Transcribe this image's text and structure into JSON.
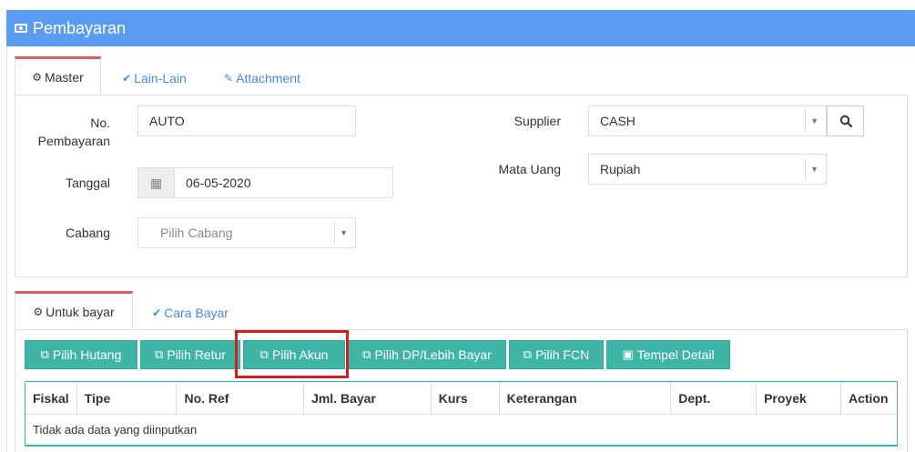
{
  "header": {
    "title": "Pembayaran",
    "icon": "money-icon"
  },
  "top_tabs": [
    {
      "label": "Master",
      "icon": "cogs-icon",
      "active": true
    },
    {
      "label": "Lain-Lain",
      "icon": "check-circle-icon",
      "active": false
    },
    {
      "label": "Attachment",
      "icon": "paperclip-icon",
      "active": false
    }
  ],
  "form": {
    "no_pembayaran": {
      "label_line1": "No.",
      "label_line2": "Pembayaran",
      "value": "AUTO"
    },
    "tanggal": {
      "label": "Tanggal",
      "value": "06-05-2020"
    },
    "cabang": {
      "label": "Cabang",
      "placeholder": "Pilih Cabang"
    },
    "supplier": {
      "label": "Supplier",
      "value": "CASH"
    },
    "mata_uang": {
      "label": "Mata Uang",
      "value": "Rupiah"
    }
  },
  "bottom_tabs": [
    {
      "label": "Untuk bayar",
      "icon": "cogs-icon",
      "active": true
    },
    {
      "label": "Cara Bayar",
      "icon": "check-circle-icon",
      "active": false
    }
  ],
  "buttons": [
    {
      "label": "Pilih Hutang",
      "icon": "copy-icon"
    },
    {
      "label": "Pilih Retur",
      "icon": "copy-icon"
    },
    {
      "label": "Pilih Akun",
      "icon": "copy-icon"
    },
    {
      "label": "Pilih DP/Lebih Bayar",
      "icon": "copy-icon"
    },
    {
      "label": "Pilih FCN",
      "icon": "copy-icon"
    },
    {
      "label": "Tempel Detail",
      "icon": "paste-icon"
    }
  ],
  "table": {
    "columns": [
      "Fiskal",
      "Tipe",
      "No. Ref",
      "Jml. Bayar",
      "Kurs",
      "Keterangan",
      "Dept.",
      "Proyek",
      "Action"
    ],
    "empty_message": "Tidak ada data yang diinputkan"
  },
  "colors": {
    "header": "#5b9cf3",
    "button": "#3fb5a6",
    "active_tab_top": "#e05a5a",
    "highlight": "#d11d1d"
  }
}
